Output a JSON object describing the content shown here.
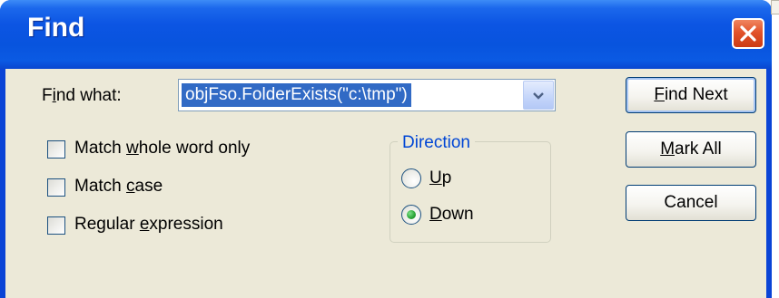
{
  "window": {
    "title": "Find"
  },
  "find_what": {
    "label_pre": "F",
    "label_u": "i",
    "label_post": "nd what:",
    "value": "objFso.FolderExists(\"c:\\tmp\")"
  },
  "options": [
    {
      "pre": "Match ",
      "u": "w",
      "post": "hole word only",
      "checked": false
    },
    {
      "pre": "Match ",
      "u": "c",
      "post": "ase",
      "checked": false
    },
    {
      "pre": "Regular ",
      "u": "e",
      "post": "xpression",
      "checked": false
    }
  ],
  "direction": {
    "legend": "Direction",
    "up": {
      "u": "U",
      "post": "p",
      "selected": false
    },
    "down": {
      "u": "D",
      "post": "own",
      "selected": true
    }
  },
  "buttons": {
    "find_next": {
      "u": "F",
      "post": "ind Next"
    },
    "mark_all": {
      "pre": "",
      "u": "M",
      "post": "ark All"
    },
    "cancel": {
      "label": "Cancel"
    }
  },
  "icons": {
    "close": "close-x-icon",
    "dropdown": "chevron-down-icon",
    "selected_radio": "radio-selected-icon"
  },
  "colors": {
    "titlebar": "#0854de",
    "client_bg": "#ece9d8",
    "selection": "#316ac5",
    "close_button": "#e2532b",
    "group_legend": "#0046d5"
  }
}
